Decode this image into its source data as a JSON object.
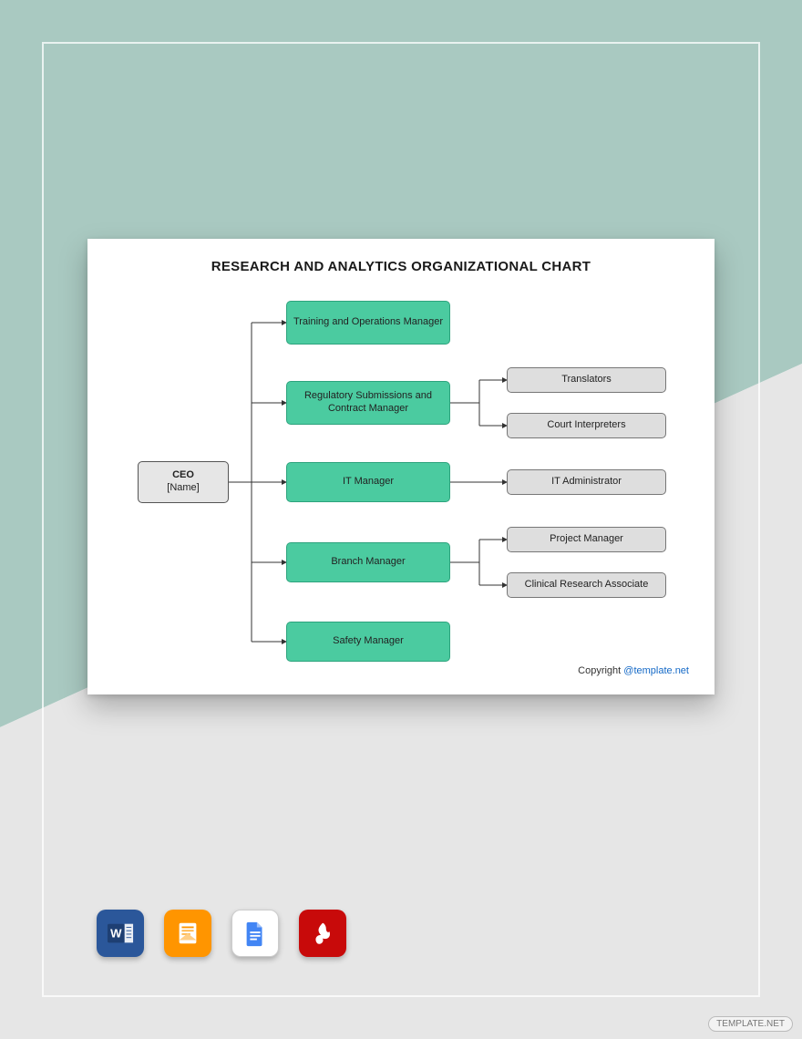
{
  "page": {
    "watermark": "TEMPLATE.NET"
  },
  "doc": {
    "title": "RESEARCH AND ANALYTICS ORGANIZATIONAL CHART",
    "copyright_prefix": "Copyright ",
    "copyright_link": "@template.net"
  },
  "chart_data": {
    "type": "org-chart",
    "root": {
      "role": "CEO",
      "name_placeholder": "[Name]",
      "children": [
        {
          "role": "Training and Operations Manager",
          "children": []
        },
        {
          "role": "Regulatory Submissions and Contract Manager",
          "children": [
            {
              "role": "Translators"
            },
            {
              "role": "Court Interpreters"
            }
          ]
        },
        {
          "role": "IT Manager",
          "children": [
            {
              "role": "IT Administrator"
            }
          ]
        },
        {
          "role": "Branch Manager",
          "children": [
            {
              "role": "Project Manager"
            },
            {
              "role": "Clinical Research Associate"
            }
          ]
        },
        {
          "role": "Safety Manager",
          "children": []
        }
      ]
    }
  },
  "nodes": {
    "ceo_role": "CEO",
    "ceo_name": "[Name]",
    "m0": "Training and Operations Manager",
    "m1": "Regulatory Submissions and Contract Manager",
    "m2": "IT Manager",
    "m3": "Branch Manager",
    "m4": "Safety Manager",
    "l0": "Translators",
    "l1": "Court Interpreters",
    "l2": "IT Administrator",
    "l3": "Project Manager",
    "l4": "Clinical Research Associate"
  },
  "colors": {
    "bg_teal": "#a9c9c1",
    "bg_grey": "#e6e6e6",
    "mgr_fill": "#4bcba0",
    "leaf_fill": "#dedede"
  },
  "appicons": {
    "word": "Microsoft Word",
    "pages": "Apple Pages",
    "gdocs": "Google Docs",
    "pdf": "Adobe PDF"
  }
}
